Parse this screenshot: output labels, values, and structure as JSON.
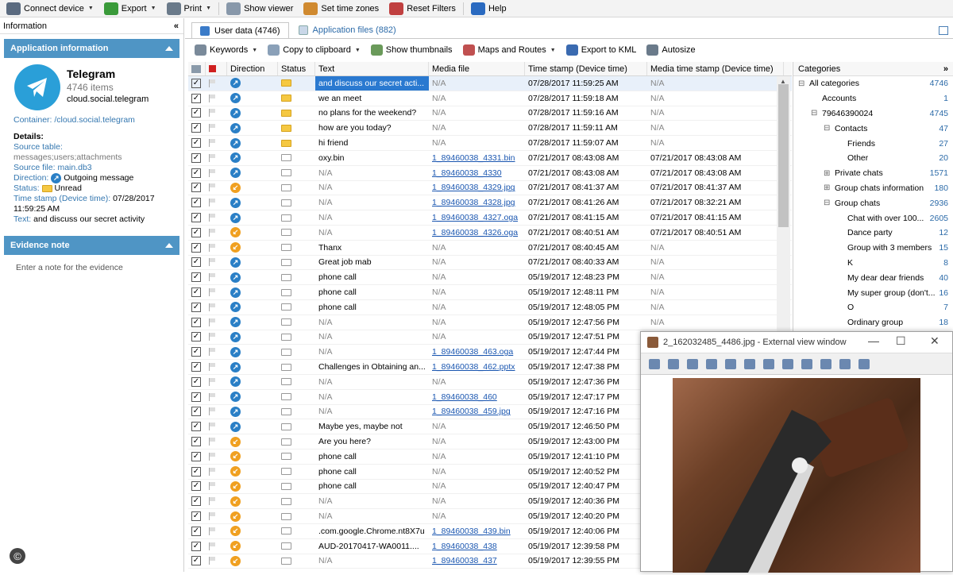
{
  "toolbar": {
    "items": [
      {
        "label": "Connect device",
        "icon": "usb-plug-icon",
        "dropdown": true
      },
      {
        "label": "Export",
        "icon": "export-icon",
        "dropdown": true
      },
      {
        "label": "Print",
        "icon": "printer-icon",
        "dropdown": true
      },
      {
        "label": "Show viewer",
        "icon": "magnifier-icon",
        "dropdown": false
      },
      {
        "label": "Set time zones",
        "icon": "globe-clock-icon",
        "dropdown": false
      },
      {
        "label": "Reset Filters",
        "icon": "filter-reset-icon",
        "dropdown": false
      },
      {
        "label": "Help",
        "icon": "help-icon",
        "dropdown": false
      }
    ]
  },
  "left_panel": {
    "header": "Information",
    "collapse_glyph": "«",
    "app_section_title": "Application information",
    "app_name": "Telegram",
    "app_items": "4746 items",
    "app_package": "cloud.social.telegram",
    "container_label": "Container:",
    "container_value": "/cloud.social.telegram",
    "details_label": "Details:",
    "source_table_label": "Source table:",
    "source_table_value": "messages;users;attachments",
    "source_file_label": "Source file:",
    "source_file_value": "main.db3",
    "direction_label": "Direction:",
    "direction_value": "Outgoing message",
    "status_label": "Status:",
    "status_value": "Unread",
    "timestamp_label": "Time stamp (Device time):",
    "timestamp_value": "07/28/2017 11:59:25 AM",
    "text_label": "Text:",
    "text_value": "and discuss our secret activity",
    "evidence_title": "Evidence note",
    "evidence_placeholder": "Enter a note for the evidence",
    "copyright_glyph": "©"
  },
  "tabs": [
    {
      "label": "User data (4746)",
      "active": true
    },
    {
      "label": "Application files (882)",
      "active": false
    }
  ],
  "subtoolbar": [
    {
      "label": "Keywords",
      "dropdown": true
    },
    {
      "label": "Copy to clipboard",
      "dropdown": true
    },
    {
      "label": "Show thumbnails",
      "dropdown": false
    },
    {
      "label": "Maps and Routes",
      "dropdown": true
    },
    {
      "label": "Export to KML",
      "dropdown": false
    },
    {
      "label": "Autosize",
      "dropdown": false
    }
  ],
  "grid": {
    "columns": [
      "",
      "",
      "Direction",
      "Status",
      "Text",
      "Media file",
      "Time stamp (Device time)",
      "Media time stamp (Device time)"
    ],
    "rows": [
      {
        "dir": "out",
        "status": "unread",
        "text": "and discuss our secret acti...",
        "media": "N/A",
        "ts": "07/28/2017 11:59:25 AM",
        "mts": "N/A",
        "selected": true
      },
      {
        "dir": "out",
        "status": "unread",
        "text": "we an meet",
        "media": "N/A",
        "ts": "07/28/2017 11:59:18 AM",
        "mts": "N/A"
      },
      {
        "dir": "out",
        "status": "unread",
        "text": "no plans for the weekend?",
        "media": "N/A",
        "ts": "07/28/2017 11:59:16 AM",
        "mts": "N/A"
      },
      {
        "dir": "out",
        "status": "unread",
        "text": "how are you today?",
        "media": "N/A",
        "ts": "07/28/2017 11:59:11 AM",
        "mts": "N/A"
      },
      {
        "dir": "out",
        "status": "unread",
        "text": "hi friend",
        "media": "N/A",
        "ts": "07/28/2017 11:59:07 AM",
        "mts": "N/A"
      },
      {
        "dir": "out",
        "status": "read",
        "text": "oxy.bin",
        "media": "1_89460038_4331.bin",
        "ts": "07/21/2017 08:43:08 AM",
        "mts": "07/21/2017 08:43:08 AM"
      },
      {
        "dir": "out",
        "status": "read",
        "text": "N/A",
        "media": "1_89460038_4330",
        "ts": "07/21/2017 08:43:08 AM",
        "mts": "07/21/2017 08:43:08 AM"
      },
      {
        "dir": "in",
        "status": "read",
        "text": "N/A",
        "media": "1_89460038_4329.jpg",
        "ts": "07/21/2017 08:41:37 AM",
        "mts": "07/21/2017 08:41:37 AM"
      },
      {
        "dir": "out",
        "status": "read",
        "text": "N/A",
        "media": "1_89460038_4328.jpg",
        "ts": "07/21/2017 08:41:26 AM",
        "mts": "07/21/2017 08:32:21 AM"
      },
      {
        "dir": "out",
        "status": "read",
        "text": "N/A",
        "media": "1_89460038_4327.oga",
        "ts": "07/21/2017 08:41:15 AM",
        "mts": "07/21/2017 08:41:15 AM"
      },
      {
        "dir": "in",
        "status": "read",
        "text": "N/A",
        "media": "1_89460038_4326.oga",
        "ts": "07/21/2017 08:40:51 AM",
        "mts": "07/21/2017 08:40:51 AM"
      },
      {
        "dir": "in",
        "status": "read",
        "text": "Thanx",
        "media": "N/A",
        "ts": "07/21/2017 08:40:45 AM",
        "mts": "N/A"
      },
      {
        "dir": "out",
        "status": "read",
        "text": "Great job mab",
        "media": "N/A",
        "ts": "07/21/2017 08:40:33 AM",
        "mts": "N/A"
      },
      {
        "dir": "out",
        "status": "read",
        "text": "phone call",
        "media": "N/A",
        "ts": "05/19/2017 12:48:23 PM",
        "mts": "N/A"
      },
      {
        "dir": "out",
        "status": "read",
        "text": "phone call",
        "media": "N/A",
        "ts": "05/19/2017 12:48:11 PM",
        "mts": "N/A"
      },
      {
        "dir": "out",
        "status": "read",
        "text": "phone call",
        "media": "N/A",
        "ts": "05/19/2017 12:48:05 PM",
        "mts": "N/A"
      },
      {
        "dir": "out",
        "status": "read",
        "text": "N/A",
        "media": "N/A",
        "ts": "05/19/2017 12:47:56 PM",
        "mts": "N/A"
      },
      {
        "dir": "out",
        "status": "read",
        "text": "N/A",
        "media": "N/A",
        "ts": "05/19/2017 12:47:51 PM",
        "mts": "N/A"
      },
      {
        "dir": "out",
        "status": "read",
        "text": "N/A",
        "media": "1_89460038_463.oga",
        "ts": "05/19/2017 12:47:44 PM",
        "mts": ""
      },
      {
        "dir": "out",
        "status": "read",
        "text": "Challenges in Obtaining an...",
        "media": "1_89460038_462.pptx",
        "ts": "05/19/2017 12:47:38 PM",
        "mts": ""
      },
      {
        "dir": "out",
        "status": "read",
        "text": "N/A",
        "media": "N/A",
        "ts": "05/19/2017 12:47:36 PM",
        "mts": ""
      },
      {
        "dir": "out",
        "status": "read",
        "text": "N/A",
        "media": "1_89460038_460",
        "ts": "05/19/2017 12:47:17 PM",
        "mts": ""
      },
      {
        "dir": "out",
        "status": "read",
        "text": "N/A",
        "media": "1_89460038_459.jpg",
        "ts": "05/19/2017 12:47:16 PM",
        "mts": ""
      },
      {
        "dir": "out",
        "status": "read",
        "text": "Maybe yes, maybe not",
        "media": "N/A",
        "ts": "05/19/2017 12:46:50 PM",
        "mts": ""
      },
      {
        "dir": "in",
        "status": "read",
        "text": "Are you here?",
        "media": "N/A",
        "ts": "05/19/2017 12:43:00 PM",
        "mts": ""
      },
      {
        "dir": "in",
        "status": "read",
        "text": "phone call",
        "media": "N/A",
        "ts": "05/19/2017 12:41:10 PM",
        "mts": ""
      },
      {
        "dir": "in",
        "status": "read",
        "text": "phone call",
        "media": "N/A",
        "ts": "05/19/2017 12:40:52 PM",
        "mts": ""
      },
      {
        "dir": "in",
        "status": "read",
        "text": "phone call",
        "media": "N/A",
        "ts": "05/19/2017 12:40:47 PM",
        "mts": ""
      },
      {
        "dir": "in",
        "status": "read",
        "text": "N/A",
        "media": "N/A",
        "ts": "05/19/2017 12:40:36 PM",
        "mts": ""
      },
      {
        "dir": "in",
        "status": "read",
        "text": "N/A",
        "media": "N/A",
        "ts": "05/19/2017 12:40:20 PM",
        "mts": ""
      },
      {
        "dir": "in",
        "status": "read",
        "text": ".com.google.Chrome.nt8X7u",
        "media": "1_89460038_439.bin",
        "ts": "05/19/2017 12:40:06 PM",
        "mts": ""
      },
      {
        "dir": "in",
        "status": "read",
        "text": "AUD-20170417-WA0011....",
        "media": "1_89460038_438",
        "ts": "05/19/2017 12:39:58 PM",
        "mts": ""
      },
      {
        "dir": "in",
        "status": "read",
        "text": "N/A",
        "media": "1_89460038_437",
        "ts": "05/19/2017 12:39:55 PM",
        "mts": ""
      }
    ]
  },
  "categories": {
    "header": "Categories",
    "expand_glyph": "»",
    "items": [
      {
        "label": "All categories",
        "count": "4746",
        "level": 0,
        "toggle": "⊟"
      },
      {
        "label": "Accounts",
        "count": "1",
        "level": 1,
        "toggle": ""
      },
      {
        "label": "79646390024",
        "count": "4745",
        "level": 1,
        "toggle": "⊟"
      },
      {
        "label": "Contacts",
        "count": "47",
        "level": 2,
        "toggle": "⊟"
      },
      {
        "label": "Friends",
        "count": "27",
        "level": 3,
        "toggle": ""
      },
      {
        "label": "Other",
        "count": "20",
        "level": 3,
        "toggle": ""
      },
      {
        "label": "Private chats",
        "count": "1571",
        "level": 2,
        "toggle": "⊞"
      },
      {
        "label": "Group chats information",
        "count": "180",
        "level": 2,
        "toggle": "⊞"
      },
      {
        "label": "Group chats",
        "count": "2936",
        "level": 2,
        "toggle": "⊟"
      },
      {
        "label": "Chat with over 100...",
        "count": "2605",
        "level": 3,
        "toggle": ""
      },
      {
        "label": "Dance party",
        "count": "12",
        "level": 3,
        "toggle": ""
      },
      {
        "label": "Group with 3 members",
        "count": "15",
        "level": 3,
        "toggle": ""
      },
      {
        "label": "K",
        "count": "8",
        "level": 3,
        "toggle": ""
      },
      {
        "label": "My dear dear friends",
        "count": "40",
        "level": 3,
        "toggle": ""
      },
      {
        "label": "My super group (don't...",
        "count": "16",
        "level": 3,
        "toggle": ""
      },
      {
        "label": "O",
        "count": "7",
        "level": 3,
        "toggle": ""
      },
      {
        "label": "Ordinary group",
        "count": "18",
        "level": 3,
        "toggle": ""
      }
    ]
  },
  "external_viewer": {
    "title": "2_162032485_4486.jpg - External view window",
    "minimize_glyph": "—",
    "maximize_glyph": "☐",
    "close_glyph": "✕"
  },
  "colors": {
    "accent": "#4f95c5",
    "selection": "#2a79d0",
    "telegram_blue": "#2a9fd8",
    "incoming": "#f0a020",
    "outgoing": "#2a7fc6"
  }
}
